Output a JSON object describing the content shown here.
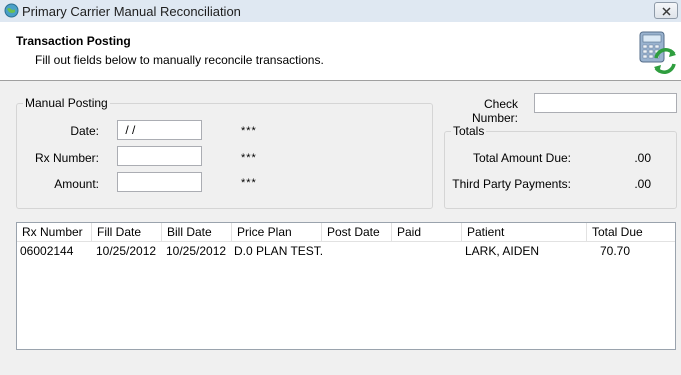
{
  "window": {
    "title": "Primary Carrier Manual Reconciliation"
  },
  "header": {
    "title": "Transaction Posting",
    "subtitle": "Fill out fields below to manually reconcile transactions."
  },
  "manual_posting": {
    "legend": "Manual Posting",
    "date_label": "Date:",
    "date_value": " / /",
    "date_flag": "***",
    "rx_label": "Rx Number:",
    "rx_value": "",
    "rx_flag": "***",
    "amount_label": "Amount:",
    "amount_value": "",
    "amount_flag": "***"
  },
  "check": {
    "label": "Check Number:",
    "value": ""
  },
  "totals": {
    "legend": "Totals",
    "total_due_label": "Total Amount Due:",
    "total_due_value": ".00",
    "third_party_label": "Third Party Payments:",
    "third_party_value": ".00"
  },
  "grid": {
    "columns": [
      "Rx Number",
      "Fill Date",
      "Bill Date",
      "Price Plan",
      "Post Date",
      "Paid",
      "Patient",
      "Total Due"
    ],
    "rows": [
      {
        "rx_number": "06002144",
        "fill_date": "10/25/2012",
        "bill_date": "10/25/2012",
        "price_plan": "D.0 PLAN TEST...",
        "post_date": "",
        "paid": "",
        "patient": "LARK, AIDEN",
        "total_due": "70.70"
      }
    ]
  },
  "icons": {
    "app": "globe-app-icon",
    "close": "close-icon",
    "header": "calculator-refresh-icon"
  }
}
